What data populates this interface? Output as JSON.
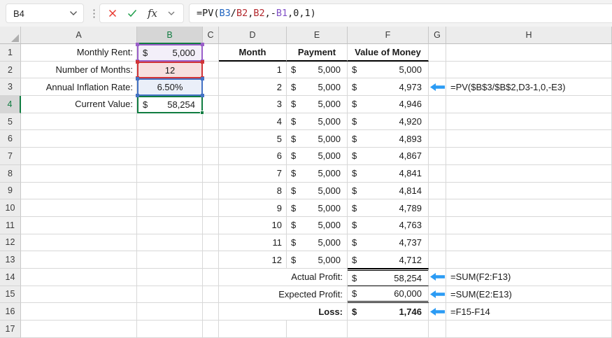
{
  "formula_bar": {
    "name_box": "B4",
    "formula_parts": [
      {
        "text": "=PV(",
        "color": "black"
      },
      {
        "text": "B3",
        "color": "blue"
      },
      {
        "text": "/",
        "color": "black"
      },
      {
        "text": "B2",
        "color": "red"
      },
      {
        "text": ",",
        "color": "black"
      },
      {
        "text": "B2",
        "color": "red"
      },
      {
        "text": ",-",
        "color": "black"
      },
      {
        "text": "B1",
        "color": "purple"
      },
      {
        "text": ",0,1)",
        "color": "black"
      }
    ],
    "icons": {
      "more": "⋮",
      "cancel": "✕",
      "enter": "✓",
      "insert_function": "fx",
      "dropdown": "⌄"
    }
  },
  "colors": {
    "selection_green": "#107C41",
    "ref_purple_border": "#9A5FC9",
    "ref_purple_fill": "#F3EFF9",
    "ref_red_border": "#D13438",
    "ref_red_fill": "#F7DFDE",
    "ref_blue_border": "#4472C4",
    "ref_blue_fill": "#EAEFF9",
    "arrow_blue": "#2B9BF4"
  },
  "sheet": {
    "column_headers": [
      "A",
      "B",
      "C",
      "D",
      "E",
      "F",
      "G",
      "H"
    ],
    "row_count": 17,
    "selected": {
      "cell": "B4",
      "column": "B",
      "row": "4"
    },
    "inputs": [
      {
        "row": 1,
        "label": "Monthly Rent:",
        "currency": "$",
        "value": "5,000",
        "align": "accounting",
        "highlight": "purple"
      },
      {
        "row": 2,
        "label": "Number of Months:",
        "currency": "",
        "value": "12",
        "align": "center",
        "highlight": "red"
      },
      {
        "row": 3,
        "label": "Annual Inflation Rate:",
        "currency": "",
        "value": "6.50%",
        "align": "center",
        "highlight": "blue"
      },
      {
        "row": 4,
        "label": "Current Value:",
        "currency": "$",
        "value": "58,254",
        "align": "accounting",
        "highlight": "selected"
      }
    ],
    "table": {
      "headers": [
        "Month",
        "Payment",
        "Value of Money"
      ],
      "currency": "$",
      "rows": [
        {
          "month": "1",
          "payment": "5,000",
          "value": "5,000"
        },
        {
          "month": "2",
          "payment": "5,000",
          "value": "4,973"
        },
        {
          "month": "3",
          "payment": "5,000",
          "value": "4,946"
        },
        {
          "month": "4",
          "payment": "5,000",
          "value": "4,920"
        },
        {
          "month": "5",
          "payment": "5,000",
          "value": "4,893"
        },
        {
          "month": "6",
          "payment": "5,000",
          "value": "4,867"
        },
        {
          "month": "7",
          "payment": "5,000",
          "value": "4,841"
        },
        {
          "month": "8",
          "payment": "5,000",
          "value": "4,814"
        },
        {
          "month": "9",
          "payment": "5,000",
          "value": "4,789"
        },
        {
          "month": "10",
          "payment": "5,000",
          "value": "4,763"
        },
        {
          "month": "11",
          "payment": "5,000",
          "value": "4,737"
        },
        {
          "month": "12",
          "payment": "5,000",
          "value": "4,712"
        }
      ]
    },
    "annotations": [
      {
        "row": 3,
        "formula": "=PV($B$3/$B$2,D3-1,0,-E3)"
      }
    ],
    "summary": [
      {
        "row": 14,
        "label": "Actual Profit:",
        "currency": "$",
        "value": "58,254",
        "formula": "=SUM(F2:F13)",
        "bold": false
      },
      {
        "row": 15,
        "label": "Expected Profit:",
        "currency": "$",
        "value": "60,000",
        "formula": "=SUM(E2:E13)",
        "bold": false
      },
      {
        "row": 16,
        "label": "Loss:",
        "currency": "$",
        "value": "1,746",
        "formula": "=F15-F14",
        "bold": true
      }
    ]
  }
}
